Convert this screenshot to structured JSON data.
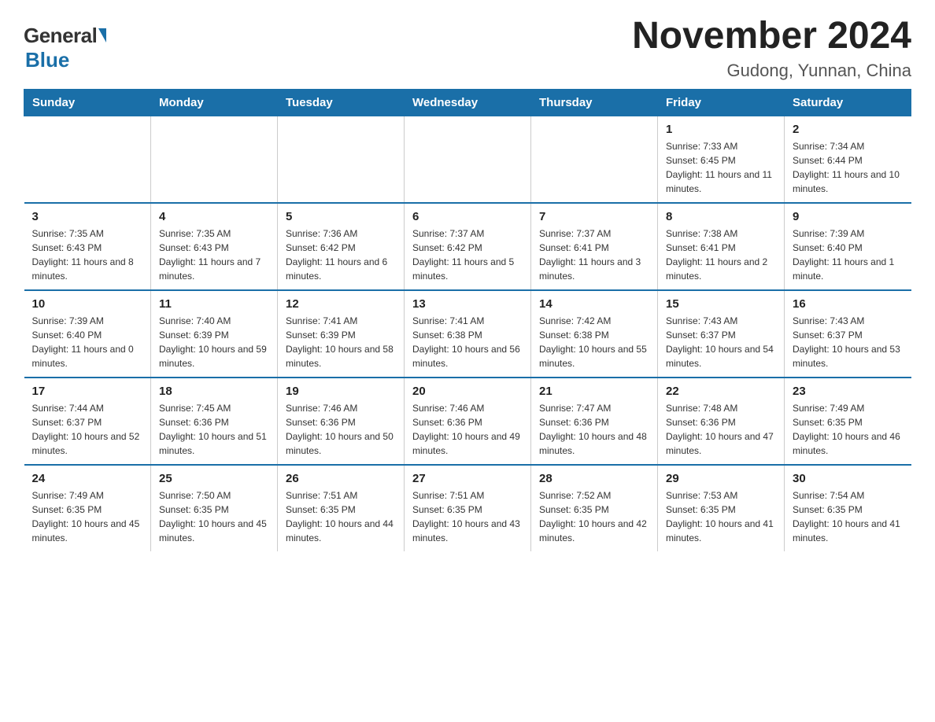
{
  "header": {
    "title": "November 2024",
    "subtitle": "Gudong, Yunnan, China",
    "logo_general": "General",
    "logo_blue": "Blue"
  },
  "days_of_week": [
    "Sunday",
    "Monday",
    "Tuesday",
    "Wednesday",
    "Thursday",
    "Friday",
    "Saturday"
  ],
  "weeks": [
    [
      {
        "day": "",
        "info": ""
      },
      {
        "day": "",
        "info": ""
      },
      {
        "day": "",
        "info": ""
      },
      {
        "day": "",
        "info": ""
      },
      {
        "day": "",
        "info": ""
      },
      {
        "day": "1",
        "info": "Sunrise: 7:33 AM\nSunset: 6:45 PM\nDaylight: 11 hours and 11 minutes."
      },
      {
        "day": "2",
        "info": "Sunrise: 7:34 AM\nSunset: 6:44 PM\nDaylight: 11 hours and 10 minutes."
      }
    ],
    [
      {
        "day": "3",
        "info": "Sunrise: 7:35 AM\nSunset: 6:43 PM\nDaylight: 11 hours and 8 minutes."
      },
      {
        "day": "4",
        "info": "Sunrise: 7:35 AM\nSunset: 6:43 PM\nDaylight: 11 hours and 7 minutes."
      },
      {
        "day": "5",
        "info": "Sunrise: 7:36 AM\nSunset: 6:42 PM\nDaylight: 11 hours and 6 minutes."
      },
      {
        "day": "6",
        "info": "Sunrise: 7:37 AM\nSunset: 6:42 PM\nDaylight: 11 hours and 5 minutes."
      },
      {
        "day": "7",
        "info": "Sunrise: 7:37 AM\nSunset: 6:41 PM\nDaylight: 11 hours and 3 minutes."
      },
      {
        "day": "8",
        "info": "Sunrise: 7:38 AM\nSunset: 6:41 PM\nDaylight: 11 hours and 2 minutes."
      },
      {
        "day": "9",
        "info": "Sunrise: 7:39 AM\nSunset: 6:40 PM\nDaylight: 11 hours and 1 minute."
      }
    ],
    [
      {
        "day": "10",
        "info": "Sunrise: 7:39 AM\nSunset: 6:40 PM\nDaylight: 11 hours and 0 minutes."
      },
      {
        "day": "11",
        "info": "Sunrise: 7:40 AM\nSunset: 6:39 PM\nDaylight: 10 hours and 59 minutes."
      },
      {
        "day": "12",
        "info": "Sunrise: 7:41 AM\nSunset: 6:39 PM\nDaylight: 10 hours and 58 minutes."
      },
      {
        "day": "13",
        "info": "Sunrise: 7:41 AM\nSunset: 6:38 PM\nDaylight: 10 hours and 56 minutes."
      },
      {
        "day": "14",
        "info": "Sunrise: 7:42 AM\nSunset: 6:38 PM\nDaylight: 10 hours and 55 minutes."
      },
      {
        "day": "15",
        "info": "Sunrise: 7:43 AM\nSunset: 6:37 PM\nDaylight: 10 hours and 54 minutes."
      },
      {
        "day": "16",
        "info": "Sunrise: 7:43 AM\nSunset: 6:37 PM\nDaylight: 10 hours and 53 minutes."
      }
    ],
    [
      {
        "day": "17",
        "info": "Sunrise: 7:44 AM\nSunset: 6:37 PM\nDaylight: 10 hours and 52 minutes."
      },
      {
        "day": "18",
        "info": "Sunrise: 7:45 AM\nSunset: 6:36 PM\nDaylight: 10 hours and 51 minutes."
      },
      {
        "day": "19",
        "info": "Sunrise: 7:46 AM\nSunset: 6:36 PM\nDaylight: 10 hours and 50 minutes."
      },
      {
        "day": "20",
        "info": "Sunrise: 7:46 AM\nSunset: 6:36 PM\nDaylight: 10 hours and 49 minutes."
      },
      {
        "day": "21",
        "info": "Sunrise: 7:47 AM\nSunset: 6:36 PM\nDaylight: 10 hours and 48 minutes."
      },
      {
        "day": "22",
        "info": "Sunrise: 7:48 AM\nSunset: 6:36 PM\nDaylight: 10 hours and 47 minutes."
      },
      {
        "day": "23",
        "info": "Sunrise: 7:49 AM\nSunset: 6:35 PM\nDaylight: 10 hours and 46 minutes."
      }
    ],
    [
      {
        "day": "24",
        "info": "Sunrise: 7:49 AM\nSunset: 6:35 PM\nDaylight: 10 hours and 45 minutes."
      },
      {
        "day": "25",
        "info": "Sunrise: 7:50 AM\nSunset: 6:35 PM\nDaylight: 10 hours and 45 minutes."
      },
      {
        "day": "26",
        "info": "Sunrise: 7:51 AM\nSunset: 6:35 PM\nDaylight: 10 hours and 44 minutes."
      },
      {
        "day": "27",
        "info": "Sunrise: 7:51 AM\nSunset: 6:35 PM\nDaylight: 10 hours and 43 minutes."
      },
      {
        "day": "28",
        "info": "Sunrise: 7:52 AM\nSunset: 6:35 PM\nDaylight: 10 hours and 42 minutes."
      },
      {
        "day": "29",
        "info": "Sunrise: 7:53 AM\nSunset: 6:35 PM\nDaylight: 10 hours and 41 minutes."
      },
      {
        "day": "30",
        "info": "Sunrise: 7:54 AM\nSunset: 6:35 PM\nDaylight: 10 hours and 41 minutes."
      }
    ]
  ]
}
